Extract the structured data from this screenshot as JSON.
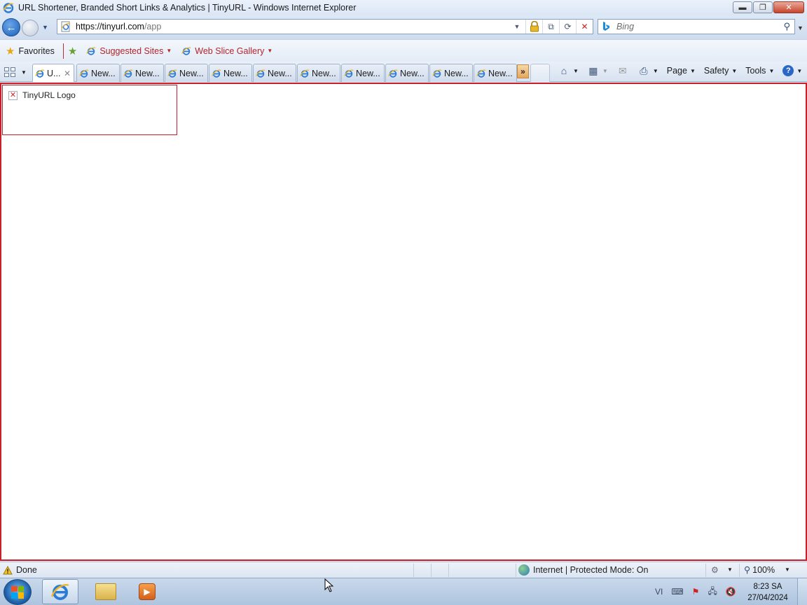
{
  "window": {
    "title": "URL Shortener, Branded Short Links & Analytics | TinyURL - Windows Internet Explorer",
    "minimize_icon": "minimize-icon",
    "restore_icon": "restore-icon",
    "close_icon": "close-icon"
  },
  "address_bar": {
    "host": "https://tinyurl.com",
    "path": "/app"
  },
  "search": {
    "placeholder": "Bing"
  },
  "favorites_bar": {
    "favorites_label": "Favorites",
    "items": [
      {
        "label": "Suggested Sites"
      },
      {
        "label": "Web Slice Gallery"
      }
    ]
  },
  "tabs": [
    {
      "label": "U...",
      "active": true
    },
    {
      "label": "New..."
    },
    {
      "label": "New..."
    },
    {
      "label": "New..."
    },
    {
      "label": "New..."
    },
    {
      "label": "New..."
    },
    {
      "label": "New..."
    },
    {
      "label": "New..."
    },
    {
      "label": "New..."
    },
    {
      "label": "New..."
    },
    {
      "label": "New..."
    }
  ],
  "tab_overflow_label": "»",
  "command_bar": {
    "page_label": "Page",
    "safety_label": "Safety",
    "tools_label": "Tools",
    "help_glyph": "?"
  },
  "content": {
    "logo_alt": "TinyURL Logo"
  },
  "status_bar": {
    "status": "Done",
    "zone": "Internet | Protected Mode: On",
    "zoom": "100%"
  },
  "taskbar": {
    "language": "VI",
    "time": "8:23 SA",
    "date": "27/04/2024"
  },
  "colors": {
    "content_border": "#c8202a",
    "favorites_link": "#b4232a",
    "chrome_background": "#dfe9f5"
  }
}
